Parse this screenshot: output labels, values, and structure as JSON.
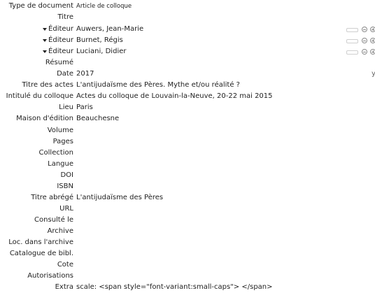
{
  "item_type": {
    "label": "Type de document",
    "value": "Article de colloque"
  },
  "title": {
    "label": "Titre",
    "value": ""
  },
  "creators": [
    {
      "label": "Éditeur",
      "value": "Auwers, Jean-Marie"
    },
    {
      "label": "Éditeur",
      "value": "Burnet, Régis"
    },
    {
      "label": "Éditeur",
      "value": "Luciani, Didier"
    }
  ],
  "fields": {
    "abstract": {
      "label": "Résumé",
      "value": ""
    },
    "date": {
      "label": "Date",
      "value": "2017",
      "suffix": "y"
    },
    "proceedings_title": {
      "label": "Titre des actes",
      "value": "L'antijudaïsme des Pères. Mythe et/ou réalité ?"
    },
    "conference_name": {
      "label": "Intitulé du colloque",
      "value": "Actes du colloque de Louvain-la-Neuve, 20-22 mai 2015"
    },
    "place": {
      "label": "Lieu",
      "value": "Paris"
    },
    "publisher": {
      "label": "Maison d'édition",
      "value": "Beauchesne"
    },
    "volume": {
      "label": "Volume",
      "value": ""
    },
    "pages": {
      "label": "Pages",
      "value": ""
    },
    "series": {
      "label": "Collection",
      "value": ""
    },
    "language": {
      "label": "Langue",
      "value": ""
    },
    "doi": {
      "label": "DOI",
      "value": ""
    },
    "isbn": {
      "label": "ISBN",
      "value": ""
    },
    "short_title": {
      "label": "Titre abrégé",
      "value": "L'antijudaïsme des Pères"
    },
    "url": {
      "label": "URL",
      "value": ""
    },
    "accessed": {
      "label": "Consulté le",
      "value": ""
    },
    "archive": {
      "label": "Archive",
      "value": ""
    },
    "archive_location": {
      "label": "Loc. dans l'archive",
      "value": ""
    },
    "library_catalog": {
      "label": "Catalogue de bibl.",
      "value": ""
    },
    "call_number": {
      "label": "Cote",
      "value": ""
    },
    "rights": {
      "label": "Autorisations",
      "value": ""
    },
    "extra": {
      "label": "Extra",
      "value": "scale: <span style=\"font-variant:small-caps\"> </span>"
    }
  },
  "icons": [
    "creator-type-menu-icon",
    "swap-name-icon",
    "remove-creator-icon",
    "add-creator-icon"
  ]
}
